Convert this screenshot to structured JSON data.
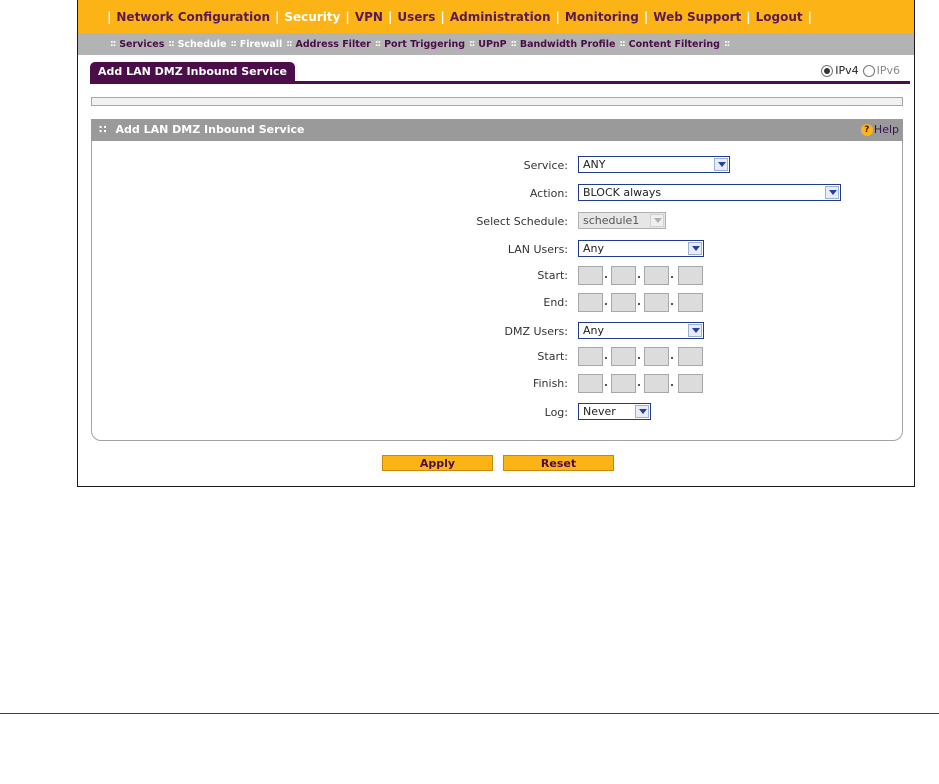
{
  "top_nav": [
    "Network Configuration",
    "Security",
    "VPN",
    "Users",
    "Administration",
    "Monitoring",
    "Web Support",
    "Logout"
  ],
  "top_nav_active": "Security",
  "sub_nav": [
    "Services",
    "Schedule",
    "Firewall",
    "Address Filter",
    "Port Triggering",
    "UPnP",
    "Bandwidth Profile",
    "Content Filtering"
  ],
  "sub_nav_active": [
    "Schedule",
    "Firewall"
  ],
  "tab": {
    "label": "Add LAN DMZ Inbound Service"
  },
  "ip_version": {
    "ipv4": "IPv4",
    "ipv6": "IPv6",
    "selected": "IPv4"
  },
  "panel": {
    "title": "Add LAN DMZ Inbound Service",
    "help": "Help"
  },
  "form": {
    "service": {
      "label": "Service:",
      "value": "ANY"
    },
    "action": {
      "label": "Action:",
      "value": "BLOCK always"
    },
    "schedule": {
      "label": "Select Schedule:",
      "value": "schedule1"
    },
    "lan_users": {
      "label": "LAN Users:",
      "value": "Any"
    },
    "lan_start": {
      "label": "Start:"
    },
    "lan_end": {
      "label": "End:"
    },
    "dmz_users": {
      "label": "DMZ Users:",
      "value": "Any"
    },
    "dmz_start": {
      "label": "Start:"
    },
    "dmz_finish": {
      "label": "Finish:"
    },
    "log": {
      "label": "Log:",
      "value": "Never"
    }
  },
  "buttons": {
    "apply": "Apply",
    "reset": "Reset"
  },
  "colors": {
    "nav_orange": "#fcb316",
    "brand_purple": "#4c0d4b",
    "subnav_gray": "#b3b3b3",
    "panel_gray": "#9a9a9a"
  }
}
